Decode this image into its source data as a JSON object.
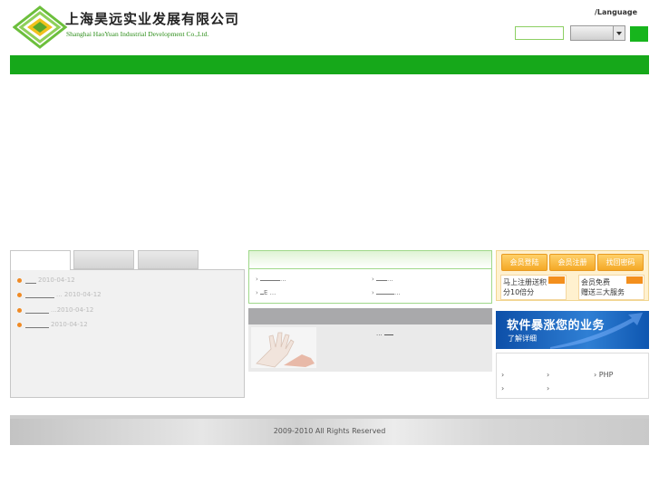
{
  "header": {
    "company_name_cn": "上海昊远实业发展有限公司",
    "company_name_en": "Shanghai HaoYuan Industrial Development Co.,Ltd.",
    "language_label": "/Language"
  },
  "news": {
    "items": [
      {
        "date": "2010-04-12",
        "suffix": ""
      },
      {
        "date": "2010-04-12",
        "suffix": "..."
      },
      {
        "date": "2010-04-12",
        "suffix": "..."
      },
      {
        "date": "2010-04-12",
        "suffix": ""
      }
    ]
  },
  "middle": {
    "links": [
      "...",
      "...",
      "E ...",
      "..."
    ],
    "product_caption": "..."
  },
  "member": {
    "login_label": "会员登陆",
    "register_label": "会员注册",
    "recover_label": "找回密码",
    "promo1_line1": "马上注册送积",
    "promo1_line2": "分10倍分",
    "promo2_line1": "会员免费",
    "promo2_line2": "赠送三大服务"
  },
  "banner": {
    "headline": "软件暴涨您的业务",
    "cta": "了解详细"
  },
  "right_links": [
    "PHP"
  ],
  "footer": {
    "copyright": "2009-2010 All Rights Reserved"
  },
  "colors": {
    "nav_green": "#16a81a",
    "accent_orange": "#f08a24",
    "banner_blue": "#0d4fa8"
  }
}
